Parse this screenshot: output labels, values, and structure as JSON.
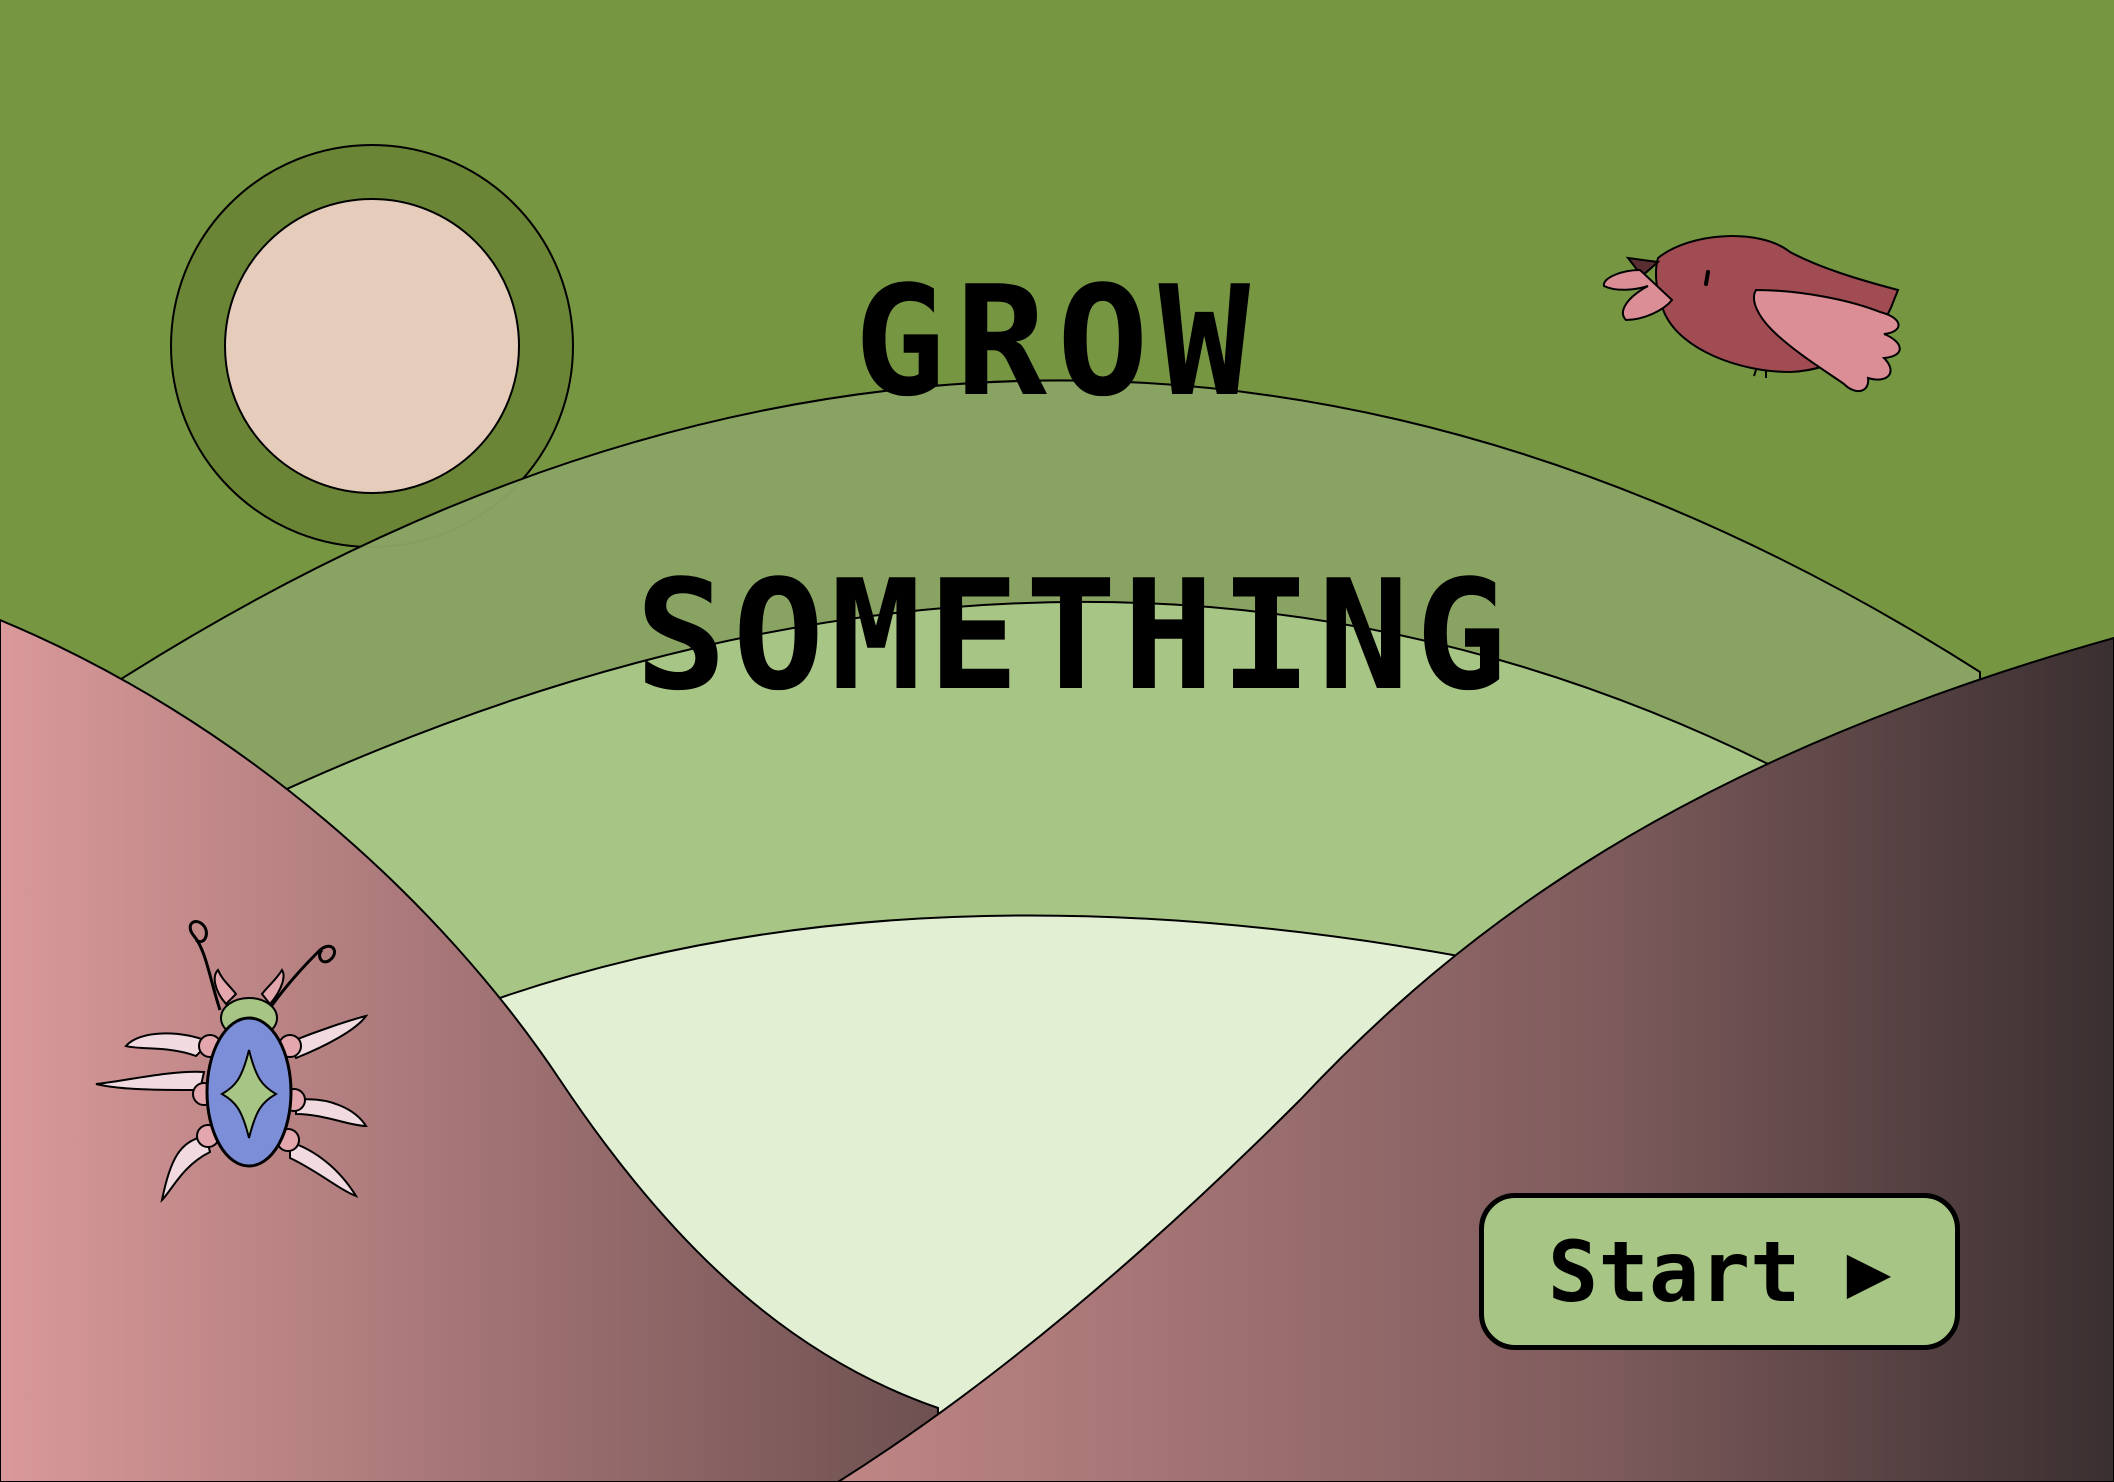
{
  "title": {
    "line1": "GROW",
    "line2": "SOMETHING"
  },
  "start_button": {
    "label": "Start",
    "arrow": "▶"
  },
  "decorations": {
    "sun": "sun-icon",
    "bird": "bird-icon",
    "beetle": "beetle-icon"
  },
  "colors": {
    "sky": "#769642",
    "outer_arch": "#89a464",
    "middle_arch": "#a7c584",
    "inner_arch": "#e2efd3",
    "sun_fill": "#e5ccbb",
    "left_hill_light": "#da999a",
    "left_hill_dark": "#735454",
    "right_hill_light": "#b98282",
    "right_hill_dark": "#3d3131",
    "button": "#a7c584"
  }
}
